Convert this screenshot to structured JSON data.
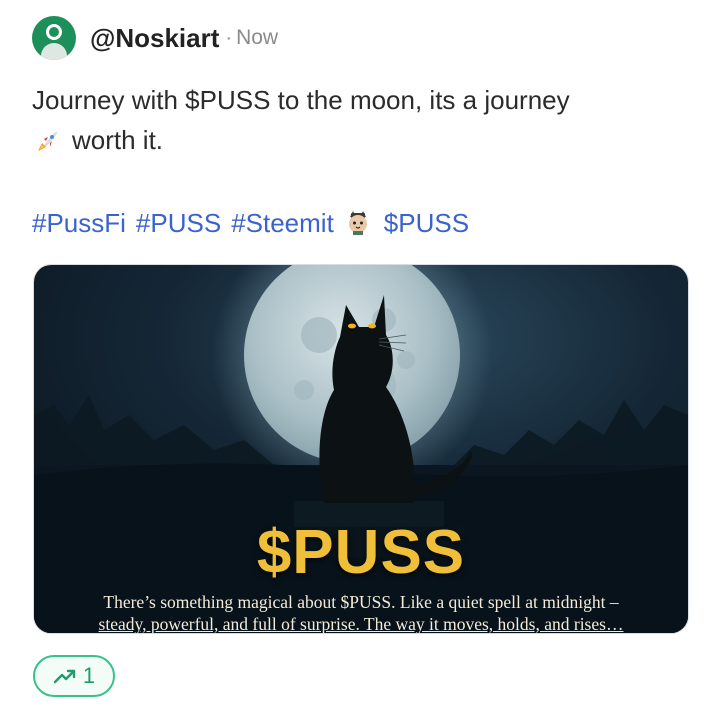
{
  "post": {
    "username": "@Noskiart",
    "separator": "·",
    "timestamp": "Now",
    "text_line1": "Journey with $PUSS to the moon, its a journey",
    "text_line2": "worth it.",
    "rocket_icon": "rocket-emoji",
    "hashtags": [
      "#PussFi",
      "#PUSS",
      "#Steemit"
    ],
    "cat_icon": "cat-emoji",
    "cashtag": "$PUSS"
  },
  "media": {
    "title": "$PUSS",
    "caption_line1": "There’s something magical about $PUSS. Like a quiet spell at midnight –",
    "caption_line2": "steady, powerful, and full of surprise. The way it moves, holds, and rises…"
  },
  "actions": {
    "upvote_icon": "trending-up-icon",
    "upvote_count": "1"
  },
  "colors": {
    "hashtag": "#3b63cf",
    "upvote": "#36c28a",
    "title_gold": "#f0bf3a"
  }
}
